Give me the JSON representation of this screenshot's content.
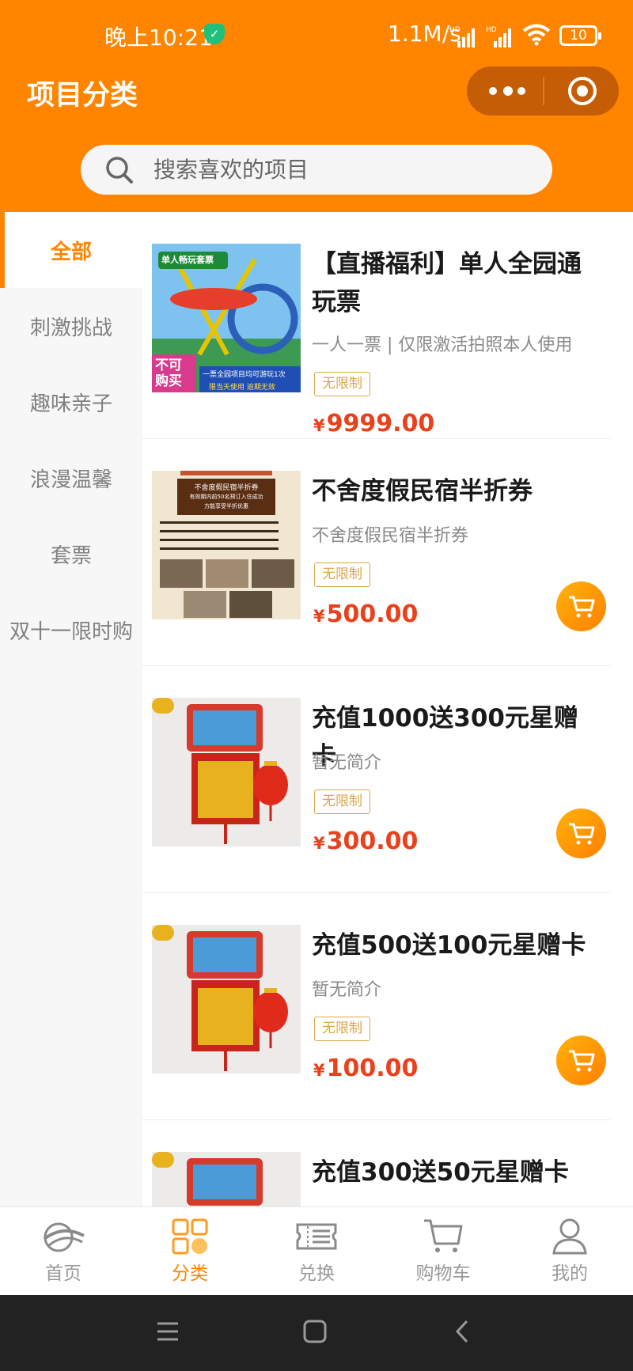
{
  "status": {
    "time": "晚上10:21",
    "speed": "1.1M/s",
    "battery": "10"
  },
  "header": {
    "title": "项目分类"
  },
  "search": {
    "placeholder": "搜索喜欢的项目"
  },
  "sidebar": {
    "items": [
      {
        "label": "全部",
        "active": true
      },
      {
        "label": "刺激挑战"
      },
      {
        "label": "趣味亲子"
      },
      {
        "label": "浪漫温馨"
      },
      {
        "label": "套票"
      },
      {
        "label": "双十一限时购"
      }
    ]
  },
  "products": [
    {
      "name": "【直播福利】单人全园通玩票",
      "desc": "一人一票 | 仅限激活拍照本人使用",
      "tag": "无限制",
      "currency": "¥",
      "price": "9999.00",
      "has_cart": false,
      "image": {
        "badge": "单人畅玩套票",
        "sold_out": "不可购买",
        "line1": "一票全园项目均可游玩1次",
        "line2": "限当天使用  逾期无效"
      }
    },
    {
      "name": "不舍度假民宿半折券",
      "desc": "不舍度假民宿半折券",
      "tag": "无限制",
      "currency": "¥",
      "price": "500.00",
      "has_cart": true,
      "image": {
        "title": "不舍度假民宿半折券",
        "sub1": "有效期内前50名预订入住成功",
        "sub2": "方能享受半折优惠"
      }
    },
    {
      "name": "充值1000送300元星赠卡",
      "desc": "暂无简介",
      "tag": "无限制",
      "currency": "¥",
      "price": "300.00",
      "has_cart": true
    },
    {
      "name": "充值500送100元星赠卡",
      "desc": "暂无简介",
      "tag": "无限制",
      "currency": "¥",
      "price": "100.00",
      "has_cart": true
    },
    {
      "name": "充值300送50元星赠卡",
      "desc": "",
      "tag": "",
      "currency": "",
      "price": "",
      "has_cart": false
    }
  ],
  "tabbar": {
    "items": [
      {
        "label": "首页",
        "icon": "home-logo-icon"
      },
      {
        "label": "分类",
        "icon": "category-grid-icon",
        "active": true
      },
      {
        "label": "兑换",
        "icon": "ticket-icon"
      },
      {
        "label": "购物车",
        "icon": "cart-icon"
      },
      {
        "label": "我的",
        "icon": "user-icon"
      }
    ]
  },
  "colors": {
    "brand": "#ff8500",
    "price": "#e8411c",
    "tag": "#d9a64a"
  }
}
